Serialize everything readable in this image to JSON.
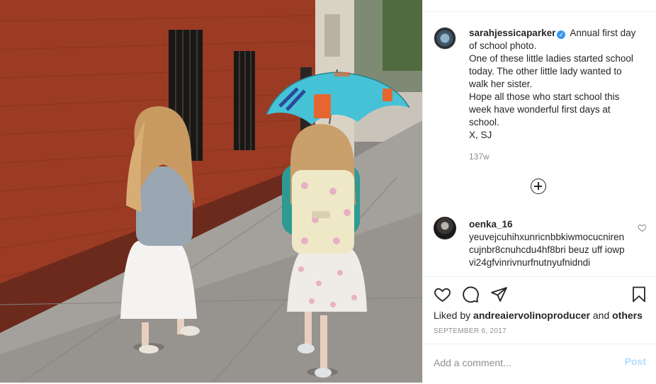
{
  "post": {
    "username": "sarahjessicaparker",
    "verified_glyph": "✓",
    "caption_lines": [
      "Annual first day of school photo.",
      "One of these little ladies started school today. The other little lady wanted to walk her sister.",
      "Hope all those who start school this week have wonderful first days at school.",
      "X, SJ"
    ],
    "time_ago": "137w",
    "load_more_icon": "plus-circle-icon"
  },
  "comment": {
    "username": "oenka_16",
    "text": "yeuvejcuhihxunricnbbkiwmocucnirencujnbr8cnuhcdu4hf8bri beuz uff iowpvi24gfvinrivnurfnutnyufnidndi"
  },
  "actions": {
    "icons": [
      "heart-icon",
      "comment-icon",
      "share-icon",
      "bookmark-icon"
    ],
    "liked_by_prefix": "Liked by",
    "liked_by_user": "andreaiervolinoproducer",
    "liked_by_and": "and",
    "liked_by_others": "others",
    "date": "SEPTEMBER 6, 2017"
  },
  "add_comment": {
    "placeholder": "Add a comment...",
    "post_label": "Post"
  },
  "colors": {
    "accent_blue": "#3897f0",
    "post_disabled": "#b3dbff",
    "muted_text": "#8e8e8e"
  }
}
